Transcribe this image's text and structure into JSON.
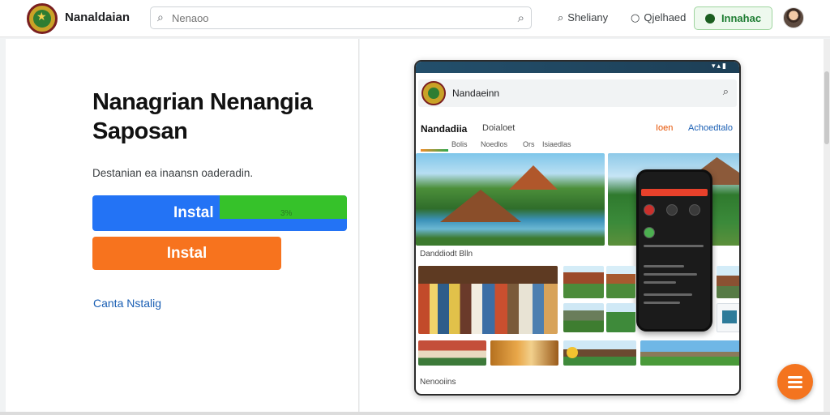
{
  "header": {
    "app_name": "Nanaldaian",
    "search_placeholder": "Nenaoo",
    "nav": [
      {
        "label": "Sheliany",
        "icon": "search-icon"
      },
      {
        "label": "Qjelhaed",
        "icon": "help-icon"
      }
    ],
    "action_button_label": "Innahac",
    "colors": {
      "accent_green": "#1e7d32",
      "logo_gold": "#c9a227"
    }
  },
  "hero": {
    "title_line1": "Nanagrian Nenangia",
    "title_line2": "Saposan",
    "subtitle": "Destanian ea inaansn oaderadin.",
    "install_primary_label": "Instal",
    "install_progress_text": "3%",
    "install_progress": 0.5,
    "install_secondary_label": "Instal",
    "link_label": "Canta Nstalig",
    "colors": {
      "primary": "#2373f5",
      "progress": "#36c22a",
      "secondary": "#f7731e"
    }
  },
  "preview": {
    "header_title": "Nandaeinn",
    "tabs": [
      "Nandadiia",
      "Doialoet",
      "Ioen",
      "Achoedtalo"
    ],
    "subtabs": [
      "Bolis",
      "Noedlos",
      "Ors",
      "Isiaedlas"
    ],
    "section1_title": "Danddiodt Blln",
    "section2_title": "Nenooiins"
  }
}
